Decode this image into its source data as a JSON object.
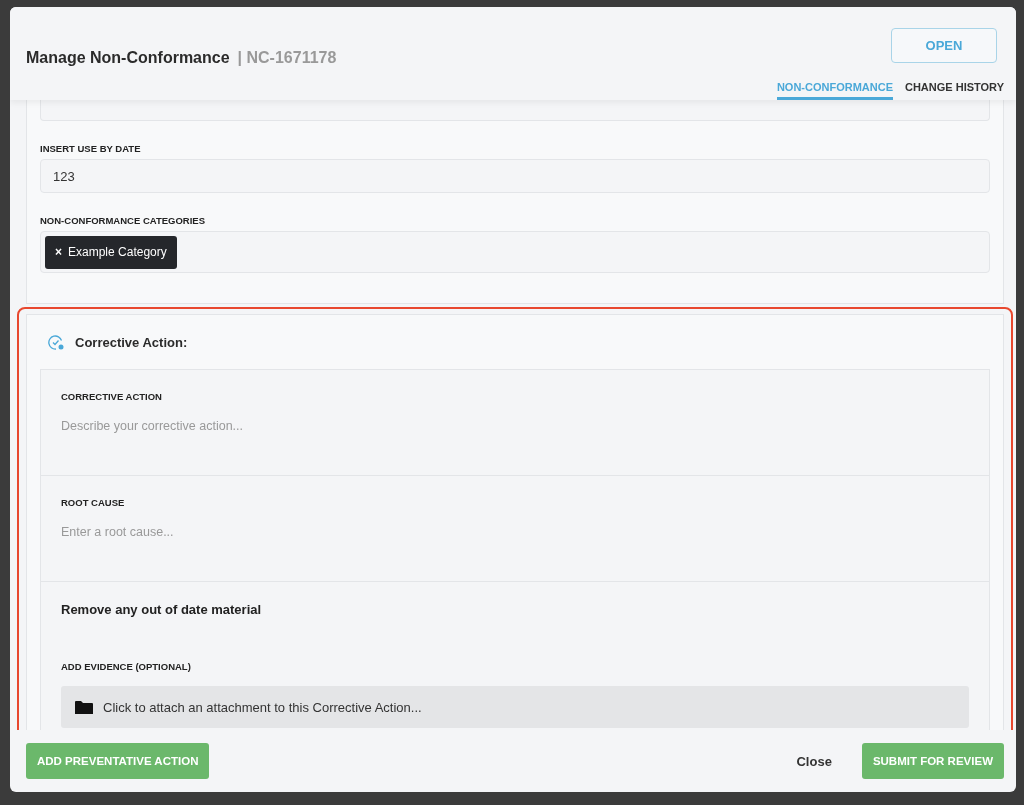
{
  "dialog": {
    "title": "Manage Non-Conformance",
    "reference": "| NC-1671178",
    "status_button": "OPEN",
    "tabs": [
      {
        "label": "NON-CONFORMANCE",
        "selected": true
      },
      {
        "label": "CHANGE HISTORY",
        "selected": false
      }
    ]
  },
  "details": {
    "fields": [
      {
        "label": "INSERT USE BY DATE",
        "kind": "text",
        "value": "123"
      },
      {
        "label": "NON-CONFORMANCE CATEGORIES",
        "kind": "tags",
        "tags": [
          {
            "remove_glyph": "×",
            "label": "Example Category"
          }
        ]
      }
    ]
  },
  "corrective_action": {
    "title": "Corrective Action:",
    "fields": [
      {
        "label": "CORRECTIVE ACTION",
        "placeholder": "Describe your corrective action..."
      },
      {
        "label": "ROOT CAUSE",
        "placeholder": "Enter a root cause..."
      }
    ],
    "action_text": "Remove any out of date material",
    "evidence_label": "ADD EVIDENCE (OPTIONAL)",
    "attachment_prompt": "Click to attach an attachment to this Corrective Action..."
  },
  "footer": {
    "left_button": "ADD PREVENTATIVE ACTION",
    "close": "Close",
    "submit": "SUBMIT FOR REVIEW"
  }
}
